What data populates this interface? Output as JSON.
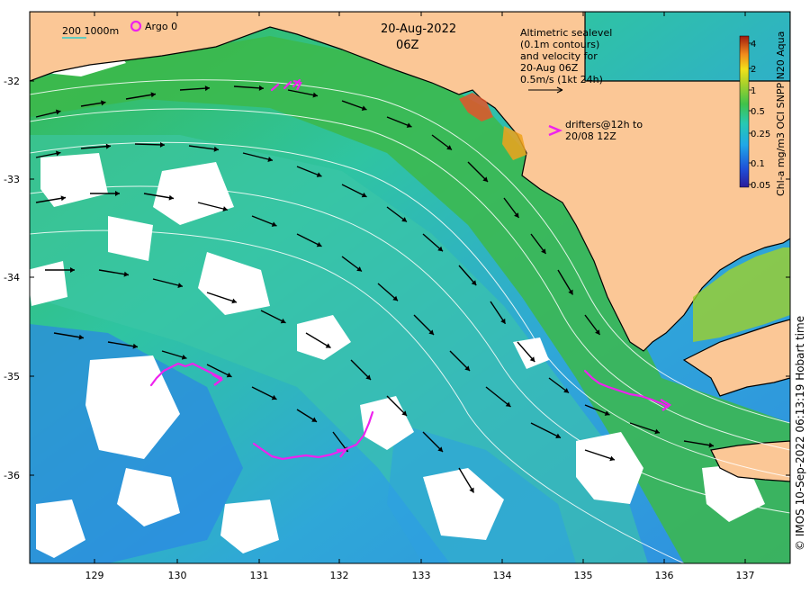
{
  "map": {
    "title_date": "20-Aug-2022",
    "title_time": "06Z",
    "scale_label": "200  1000m",
    "argo_label": "Argo 0",
    "legend_velocity_lines": [
      "Altimetric sealevel",
      "(0.1m contours)",
      "and velocity for",
      "20-Aug 06Z",
      "0.5m/s (1kt 24h)"
    ],
    "legend_drifter_lines": [
      "drifters@12h to",
      "20/08 12Z"
    ],
    "colorbar_title": "Chl-a mg/m3 OCI SNPP N20 Aqua",
    "colorbar_ticks": [
      "4",
      "2",
      "1",
      "0.5",
      "0.25",
      "0.1",
      "0.05"
    ],
    "credit": "© IMOS 10-Sep-2022 06:13:19 Hobart time",
    "lat_ticks": [
      "-32",
      "-33",
      "-34",
      "-35",
      "-36"
    ],
    "lon_ticks": [
      "129",
      "130",
      "131",
      "132",
      "133",
      "134",
      "135",
      "136",
      "137"
    ],
    "colors": {
      "land": "#fbc796",
      "ocean_high": "#2fae32",
      "ocean_mid": "#2ec7a0",
      "ocean_low": "#2e8fe0",
      "cloud": "#ffffff",
      "drifter": "#ee22ee",
      "argo": "#ee22ee",
      "contour": "#ffffff",
      "arrow": "#000000"
    }
  }
}
